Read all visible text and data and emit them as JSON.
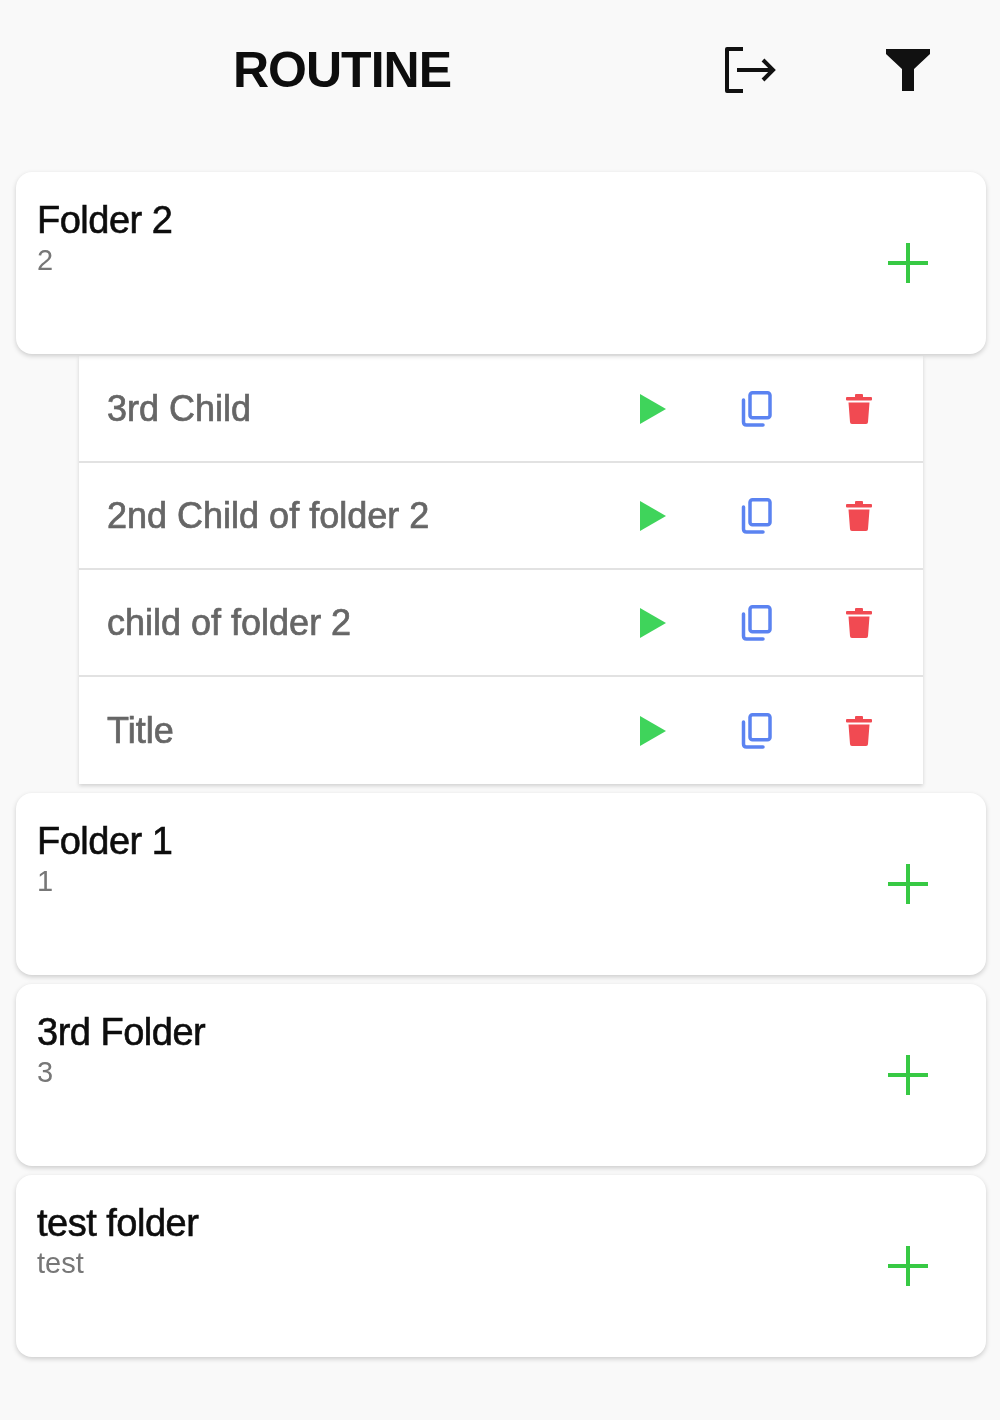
{
  "header": {
    "title": "ROUTINE"
  },
  "folders": [
    {
      "title": "Folder 2",
      "subtitle": "2",
      "children": [
        {
          "title": "3rd Child"
        },
        {
          "title": "2nd Child of folder 2"
        },
        {
          "title": "child of folder 2"
        },
        {
          "title": "Title"
        }
      ]
    },
    {
      "title": "Folder 1",
      "subtitle": "1"
    },
    {
      "title": "3rd Folder",
      "subtitle": "3"
    },
    {
      "title": "test folder",
      "subtitle": "test"
    }
  ]
}
